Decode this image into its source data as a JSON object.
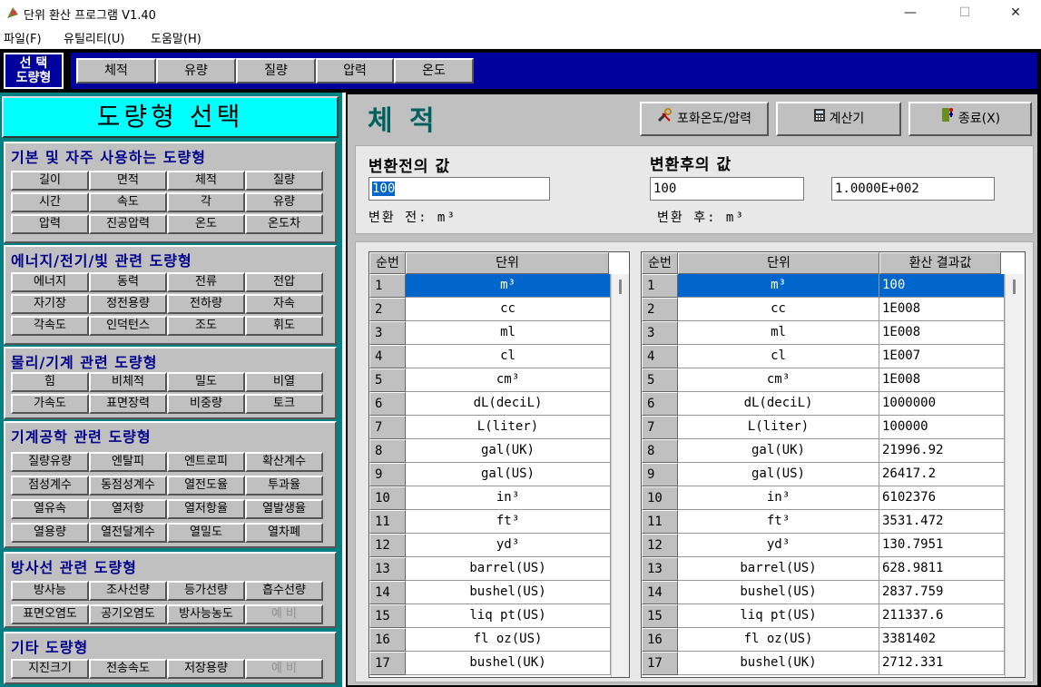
{
  "window": {
    "title": "단위 환산 프로그램 V1.40",
    "min_glyph": "—",
    "max_glyph": "☐",
    "close_glyph": "✕"
  },
  "menu": [
    "파일(F)",
    "유틸리티(U)",
    "도움말(H)"
  ],
  "top_strip": {
    "selected_label_line1": "선  택",
    "selected_label_line2": "도량형",
    "tabs": [
      "체적",
      "유량",
      "질량",
      "압력",
      "온도"
    ]
  },
  "left_panel": {
    "title": "도량형 선택",
    "groups": [
      {
        "title": "기본 및 자주 사용하는 도량형",
        "buttons": [
          "길이",
          "면적",
          "체적",
          "질량",
          "시간",
          "속도",
          "각",
          "유량",
          "압력",
          "진공압력",
          "온도",
          "온도차"
        ]
      },
      {
        "title": "에너지/전기/빛 관련 도량형",
        "buttons": [
          "에너지",
          "동력",
          "전류",
          "전압",
          "자기장",
          "정전용량",
          "전하량",
          "자속",
          "각속도",
          "인덕턴스",
          "조도",
          "휘도"
        ]
      },
      {
        "title": "물리/기계 관련 도량형",
        "buttons": [
          "힘",
          "비체적",
          "밀도",
          "비열",
          "가속도",
          "표면장력",
          "비중량",
          "토크"
        ]
      },
      {
        "title": "기계공학 관련 도량형",
        "buttons": [
          "질량유량",
          "엔탈피",
          "엔트로피",
          "확산계수",
          "점성계수",
          "동점성계수",
          "열전도율",
          "투과율",
          "열유속",
          "열저항",
          "열저항율",
          "열발생율",
          "열용량",
          "열전달계수",
          "열밀도",
          "열차폐"
        ]
      },
      {
        "title": "방사선 관련 도량형",
        "buttons": [
          "방사능",
          "조사선량",
          "등가선량",
          "흡수선량",
          "표면오염도",
          "공기오염도",
          "방사능농도",
          "예 비"
        ]
      },
      {
        "title": "기타 도량형",
        "buttons": [
          "지진크기",
          "전송속도",
          "저장용량",
          "예 비"
        ]
      }
    ]
  },
  "right_panel": {
    "title": "체 적",
    "buttons": {
      "saturation": "포화온도/압력",
      "calculator": "계산기",
      "exit": "종료(X)"
    },
    "before_label": "변환전의 값",
    "after_label": "변환후의 값",
    "before_value": "100",
    "after_value": "100",
    "after_sci": "1.0000E+002",
    "before_unit": "변환 전: m³",
    "after_unit": "변환 후: m³",
    "headers": {
      "num": "순번",
      "unit": "단위",
      "result": "환산 결과값"
    },
    "rows": [
      {
        "n": "1",
        "unit": "m³",
        "res": "100"
      },
      {
        "n": "2",
        "unit": "cc",
        "res": "1E008"
      },
      {
        "n": "3",
        "unit": "ml",
        "res": "1E008"
      },
      {
        "n": "4",
        "unit": "cl",
        "res": "1E007"
      },
      {
        "n": "5",
        "unit": "cm³",
        "res": "1E008"
      },
      {
        "n": "6",
        "unit": "dL(deciL)",
        "res": "1000000"
      },
      {
        "n": "7",
        "unit": "L(liter)",
        "res": "100000"
      },
      {
        "n": "8",
        "unit": "gal(UK)",
        "res": "21996.92"
      },
      {
        "n": "9",
        "unit": "gal(US)",
        "res": "26417.2"
      },
      {
        "n": "10",
        "unit": "in³",
        "res": "6102376"
      },
      {
        "n": "11",
        "unit": "ft³",
        "res": "3531.472"
      },
      {
        "n": "12",
        "unit": "yd³",
        "res": "130.7951"
      },
      {
        "n": "13",
        "unit": "barrel(US)",
        "res": "628.9811"
      },
      {
        "n": "14",
        "unit": "bushel(US)",
        "res": "2837.759"
      },
      {
        "n": "15",
        "unit": "liq pt(US)",
        "res": "211337.6"
      },
      {
        "n": "16",
        "unit": "fl oz(US)",
        "res": "3381402"
      },
      {
        "n": "17",
        "unit": "bushel(UK)",
        "res": "2712.331"
      }
    ]
  }
}
